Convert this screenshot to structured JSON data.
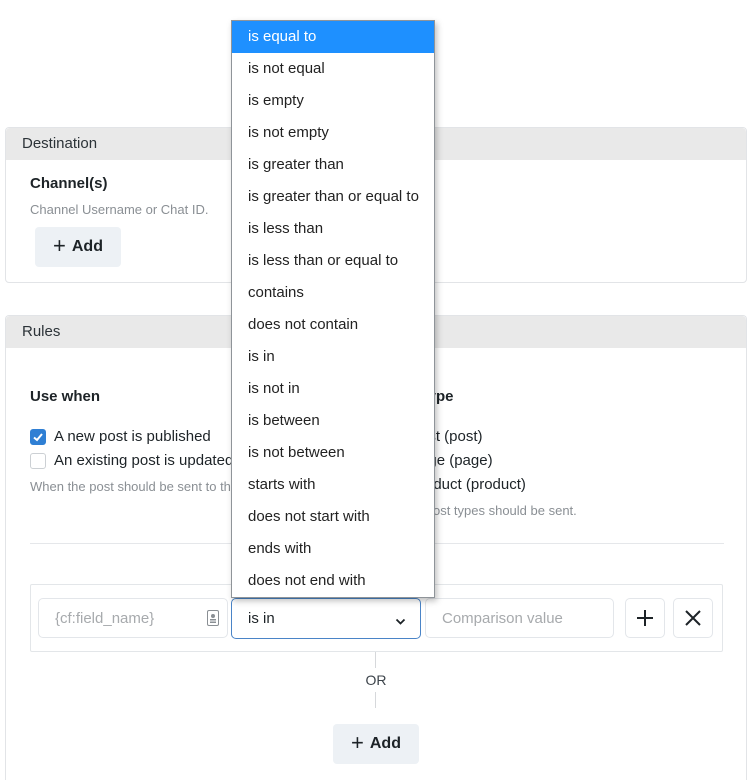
{
  "destination": {
    "title": "Destination",
    "channels_label": "Channel(s)",
    "channels_help": "Channel Username or Chat ID.",
    "add_label": "Add"
  },
  "rules": {
    "title": "Rules",
    "use_when": {
      "label": "Use when",
      "options": [
        {
          "label": "A new post is published",
          "checked": true
        },
        {
          "label": "An existing post is updated",
          "checked": false
        }
      ],
      "help": "When the post should be sent to the channel."
    },
    "post_type": {
      "label": "Post type",
      "options": [
        {
          "label": "Post (post)"
        },
        {
          "label": "Page (page)"
        },
        {
          "label": "Product (product)"
        }
      ],
      "help": "Which post types should be sent."
    },
    "condition": {
      "field_placeholder": "{cf:field_name}",
      "operator_value": "is in",
      "value_placeholder": "Comparison value"
    },
    "or_label": "OR",
    "add_label": "Add"
  },
  "operator_dropdown": {
    "selected_index": 0,
    "options": [
      "is equal to",
      "is not equal",
      "is empty",
      "is not empty",
      "is greater than",
      "is greater than or equal to",
      "is less than",
      "is less than or equal to",
      "contains",
      "does not contain",
      "is in",
      "is not in",
      "is between",
      "is not between",
      "starts with",
      "does not start with",
      "ends with",
      "does not end with"
    ]
  },
  "colors": {
    "accent": "#1e90ff",
    "checkbox": "#2f7fd4",
    "panel_header": "#e9e9e9",
    "add_button_bg": "#edf1f5"
  }
}
